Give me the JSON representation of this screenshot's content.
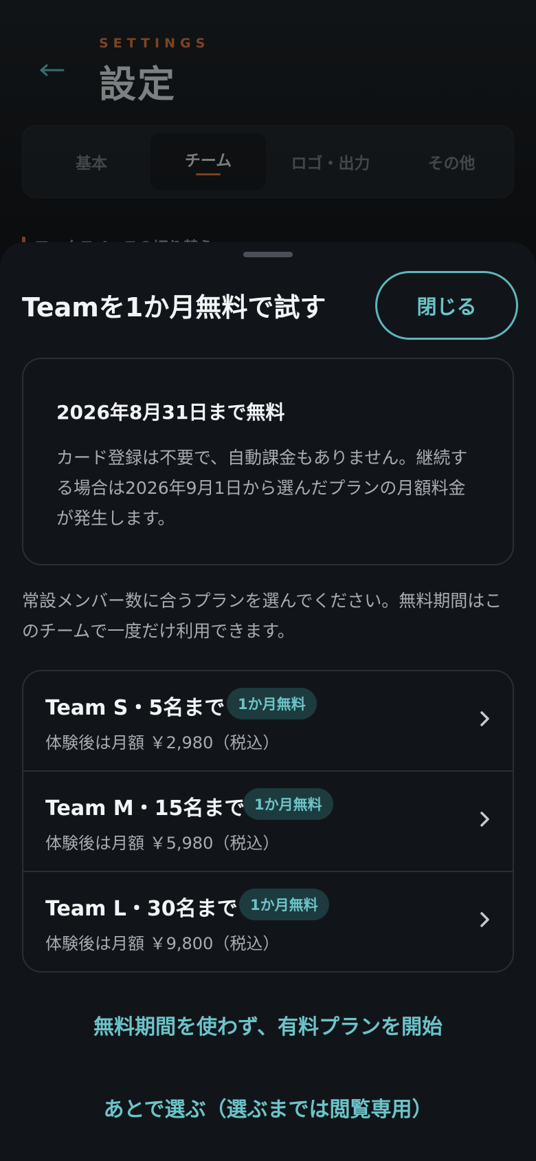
{
  "colors": {
    "accent_teal": "#6cc4c9",
    "accent_orange": "#d96b2b",
    "sheet_bg": "#111519"
  },
  "header": {
    "back_icon": "arrow-left-icon",
    "eyebrow": "SETTINGS",
    "title": "設定"
  },
  "tabs": [
    {
      "label": "基本",
      "active": false
    },
    {
      "label": "チーム",
      "active": true
    },
    {
      "label": "ロゴ・出力",
      "active": false
    },
    {
      "label": "その他",
      "active": false
    }
  ],
  "background_section": {
    "label": "ワークスペースの切り替え"
  },
  "sheet": {
    "title": "Teamを1か月無料で試す",
    "close_label": "閉じる",
    "info": {
      "title": "2026年8月31日まで無料",
      "body": "カード登録は不要で、自動課金もありません。継続する場合は2026年9月1日から選んだプランの月額料金が発生します。"
    },
    "intro": "常設メンバー数に合うプランを選んでください。無料期間はこのチームで一度だけ利用できます。",
    "plans": [
      {
        "name": "Team S・5名まで",
        "badge": "1か月無料",
        "price": "体験後は月額 ￥2,980（税込）"
      },
      {
        "name": "Team M・15名まで",
        "badge": "1か月無料",
        "price": "体験後は月額 ￥5,980（税込）"
      },
      {
        "name": "Team L・30名まで",
        "badge": "1か月無料",
        "price": "体験後は月額 ￥9,800（税込）"
      }
    ],
    "primary_link": "無料期間を使わず、有料プランを開始",
    "secondary_link": "あとで選ぶ（選ぶまでは閲覧専用）"
  }
}
